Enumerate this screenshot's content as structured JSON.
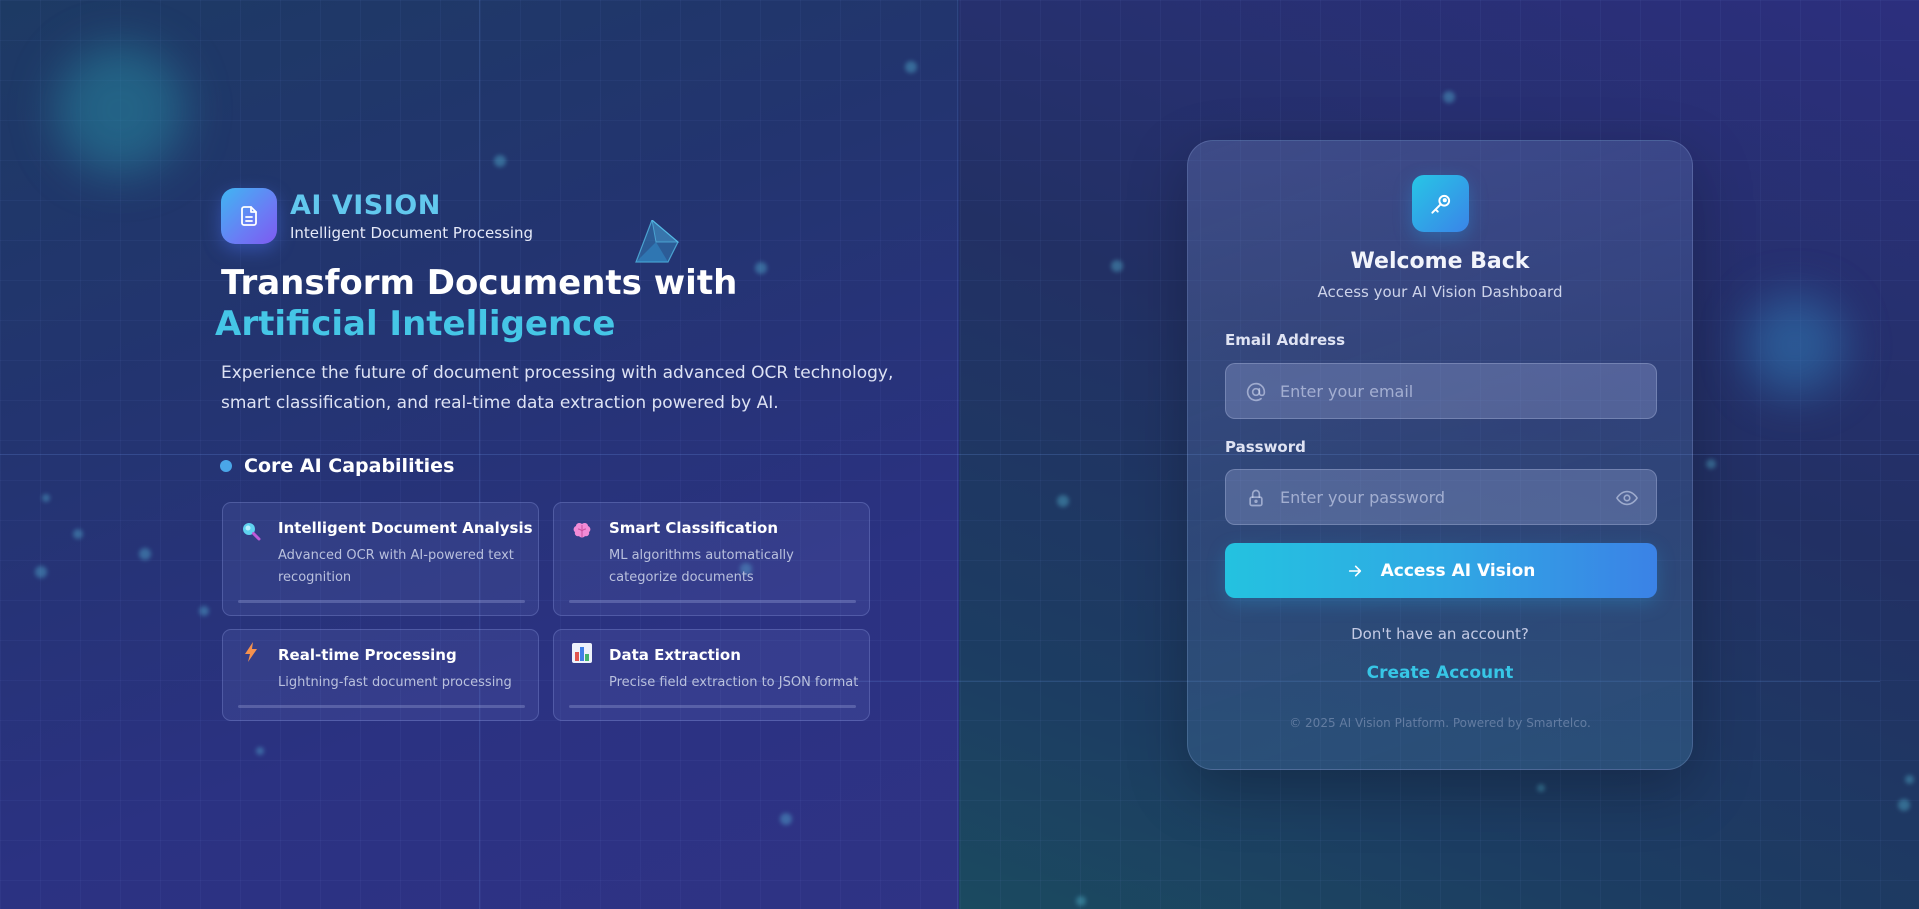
{
  "brand": {
    "name": "AI VISION",
    "tagline": "Intelligent Document Processing"
  },
  "hero": {
    "title_line1": "Transform Documents with",
    "title_line2": "Artificial Intelligence",
    "description": "Experience the future of document processing with advanced OCR technology, smart classification, and real-time data extraction powered by AI."
  },
  "capabilities": {
    "heading": "Core AI Capabilities",
    "items": [
      {
        "icon": "magnifier-icon",
        "title": "Intelligent Document Analysis",
        "description": "Advanced OCR with AI-powered text recognition"
      },
      {
        "icon": "brain-icon",
        "title": "Smart Classification",
        "description": "ML algorithms automatically categorize documents"
      },
      {
        "icon": "lightning-icon",
        "title": "Real-time Processing",
        "description": "Lightning-fast document processing"
      },
      {
        "icon": "bar-chart-icon",
        "title": "Data Extraction",
        "description": "Precise field extraction to JSON format"
      }
    ]
  },
  "login": {
    "icon": "key-icon",
    "title": "Welcome Back",
    "subtitle": "Access your AI Vision Dashboard",
    "email_label": "Email Address",
    "email_placeholder": "Enter your email",
    "email_value": "",
    "password_label": "Password",
    "password_placeholder": "Enter your password",
    "password_value": "",
    "submit_label": "Access AI Vision",
    "no_account_text": "Don't have an account?",
    "create_account_label": "Create Account",
    "footer": "© 2025 AI Vision Platform. Powered by Smartelco."
  },
  "colors": {
    "accent_cyan": "#37c6e6",
    "accent_blue": "#3b82e6",
    "background_left": "#233470",
    "background_right": "#1c3d62"
  }
}
